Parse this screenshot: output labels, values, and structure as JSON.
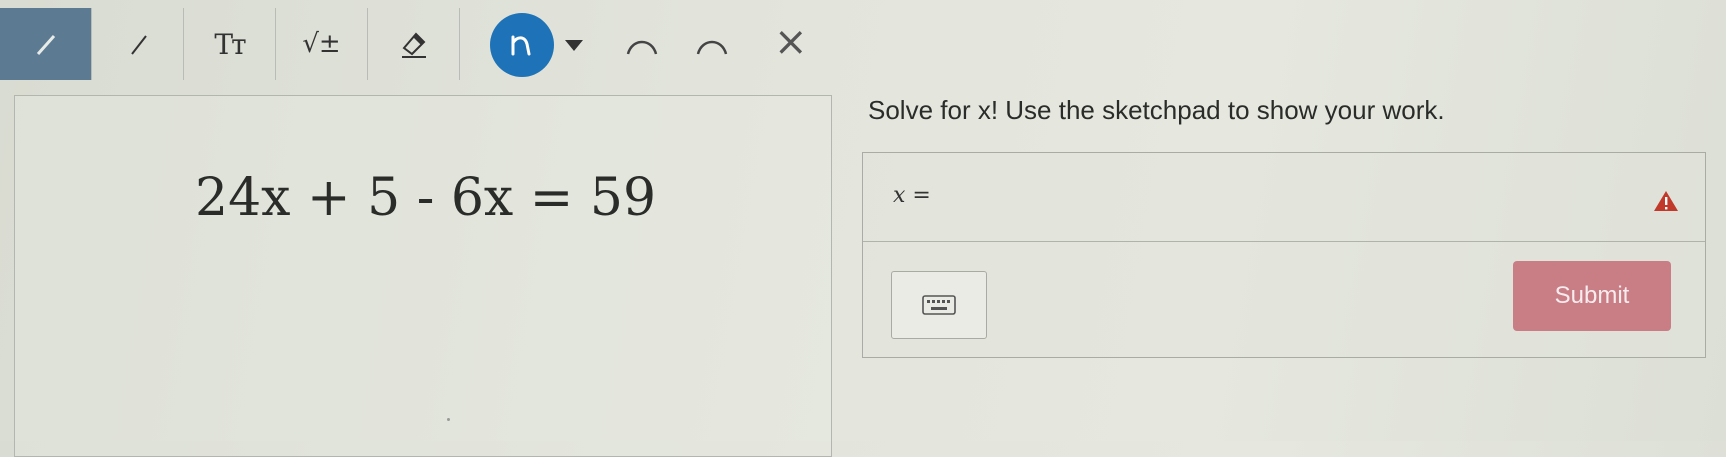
{
  "toolbar": {
    "tools": [
      {
        "name": "pen-tool",
        "icon": "pen-icon"
      },
      {
        "name": "line-tool",
        "icon": "line-icon"
      },
      {
        "name": "text-tool",
        "icon": "text-icon",
        "label": "Tт"
      },
      {
        "name": "math-tool",
        "icon": "sqrt-icon",
        "label": "√±"
      },
      {
        "name": "eraser-tool",
        "icon": "eraser-icon"
      }
    ],
    "active_pen_icon": "freehand-pen-icon",
    "undo_icon": "undo-arc-icon",
    "redo_icon": "redo-arc-icon",
    "close_label": "×",
    "colors": {
      "active_tool_bg": "#5c7b93",
      "pen_circle": "#1e73b8"
    }
  },
  "sketchpad": {
    "equation": "24x + 5 - 6x = 59"
  },
  "question": {
    "prompt": "Solve for x! Use the sketchpad to show your work.",
    "answer_label": "x =",
    "answer_value": "",
    "warning_icon": "warning-triangle-icon",
    "keyboard_icon": "keyboard-icon",
    "submit_label": "Submit",
    "colors": {
      "submit_bg": "#c97e86",
      "warning": "#c0392b"
    }
  }
}
